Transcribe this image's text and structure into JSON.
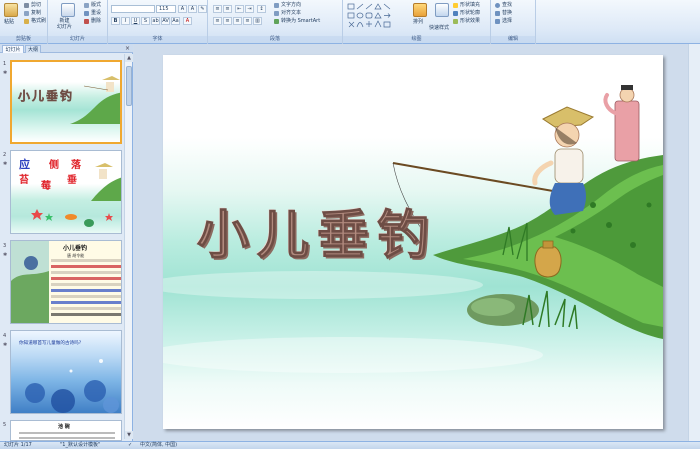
{
  "ribbon": {
    "clipboard": {
      "paste_label": "粘贴",
      "cut_label": "剪切",
      "copy_label": "复制",
      "format_painter_label": "格式刷",
      "group_label": "剪贴板"
    },
    "slides": {
      "new_slide_label": "新建\n幻灯片",
      "layout_label": "版式",
      "reset_label": "重设",
      "delete_label": "删除",
      "group_label": "幻灯片"
    },
    "font": {
      "font_size": "115",
      "group_label": "字体"
    },
    "paragraph": {
      "text_direction_label": "文字方向",
      "align_text_label": "对齐文本",
      "smartart_label": "转换为 SmartArt",
      "group_label": "段落"
    },
    "drawing": {
      "arrange_label": "排列",
      "quick_styles_label": "快速样式",
      "shape_fill_label": "形状填充",
      "shape_outline_label": "形状轮廓",
      "shape_effects_label": "形状效果",
      "group_label": "绘图"
    },
    "editing": {
      "find_label": "查找",
      "replace_label": "替换",
      "select_label": "选择",
      "group_label": "编辑"
    }
  },
  "left_pane": {
    "tabs": [
      "幻灯片",
      "大纲"
    ],
    "close_glyph": "×",
    "thumbnails": [
      {
        "number": "1",
        "star": "✱",
        "title": "小儿垂钓"
      },
      {
        "number": "2",
        "star": "✱",
        "chars": [
          "应",
          "侧",
          "落",
          "苔",
          "莓",
          "垂"
        ]
      },
      {
        "number": "3",
        "star": "✱",
        "title": "小儿垂钓",
        "author": "唐  胡令能"
      },
      {
        "number": "4",
        "star": "✱",
        "text": "你知道哪首写儿童做的古诗吗?"
      },
      {
        "number": "5",
        "star": "",
        "title": "池  碗"
      }
    ]
  },
  "slide": {
    "title": "小儿垂钓"
  },
  "status_bar": {
    "slide_counter": "幻灯片 1/17",
    "theme": "\"1_默认设计模板\"",
    "language": "中文(简体, 中国)"
  },
  "colors": {
    "ribbon_bg": "#dde9f7",
    "pane_bg": "#dfe9f5",
    "selection_border": "#f0a830",
    "title_color": "#b18a7e",
    "water_teal": "#9fe3d3",
    "grass_green": "#4f9a3c"
  }
}
